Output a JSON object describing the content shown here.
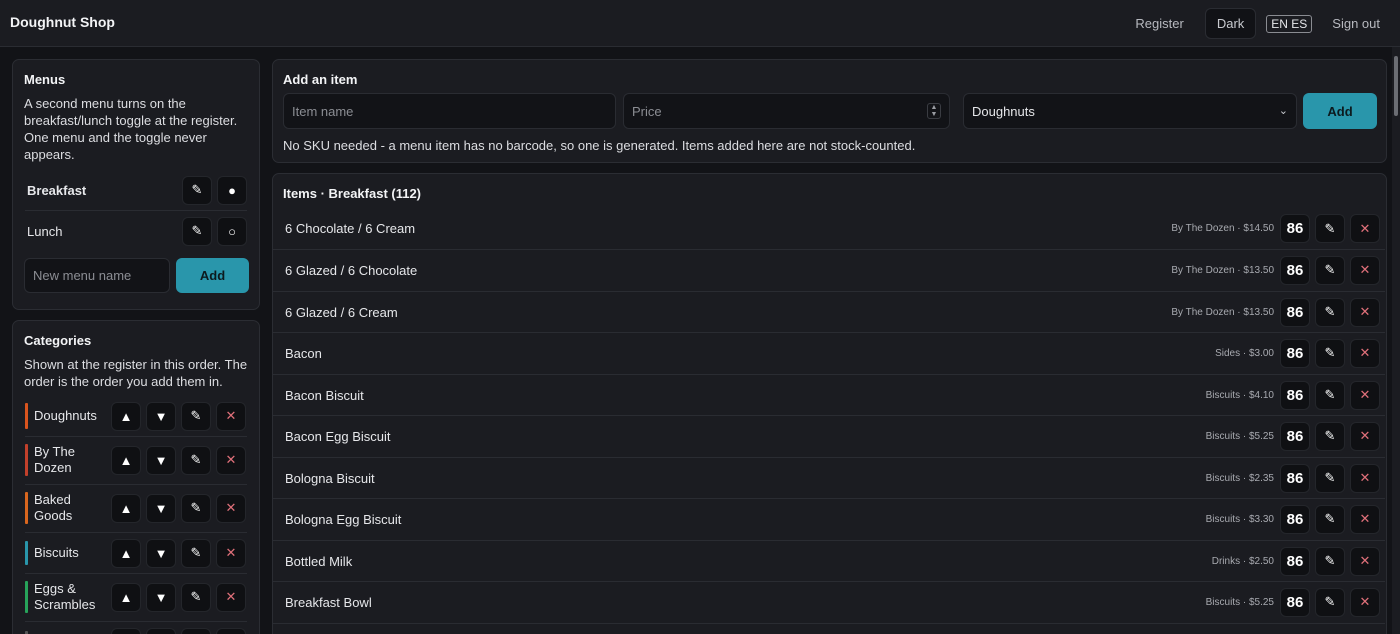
{
  "header": {
    "brand": "Doughnut Shop",
    "register": "Register",
    "theme": "Dark",
    "language": "EN ES",
    "signout": "Sign out"
  },
  "menus": {
    "title": "Menus",
    "description": "A second menu turns on the breakfast/lunch toggle at the register. One menu and the toggle never appears.",
    "items": [
      {
        "name": "Breakfast",
        "active": true,
        "status_icon": "●"
      },
      {
        "name": "Lunch",
        "active": false,
        "status_icon": "○"
      }
    ],
    "new_placeholder": "New menu name",
    "add_label": "Add"
  },
  "categories": {
    "title": "Categories",
    "description": "Shown at the register in this order. The order is the order you add them in.",
    "items": [
      {
        "name": "Doughnuts",
        "color": "#d9541e"
      },
      {
        "name": "By The Dozen",
        "color": "#c2402b"
      },
      {
        "name": "Baked Goods",
        "color": "#d9661e"
      },
      {
        "name": "Biscuits",
        "color": "#2996ab"
      },
      {
        "name": "Eggs & Scrambles",
        "color": "#27a35a"
      }
    ]
  },
  "add_item": {
    "title": "Add an item",
    "name_placeholder": "Item name",
    "price_placeholder": "Price",
    "category_selected": "Doughnuts",
    "add_label": "Add",
    "note": "No SKU needed - a menu item has no barcode, so one is generated. Items added here are not stock-counted."
  },
  "items": {
    "title": "Items · Breakfast (112)",
    "badge": "86",
    "rows": [
      {
        "name": "6 Chocolate / 6 Cream",
        "meta": "By The Dozen · $14.50"
      },
      {
        "name": "6 Glazed / 6 Chocolate",
        "meta": "By The Dozen · $13.50"
      },
      {
        "name": "6 Glazed / 6 Cream",
        "meta": "By The Dozen · $13.50"
      },
      {
        "name": "Bacon",
        "meta": "Sides · $3.00"
      },
      {
        "name": "Bacon Biscuit",
        "meta": "Biscuits · $4.10"
      },
      {
        "name": "Bacon Egg Biscuit",
        "meta": "Biscuits · $5.25"
      },
      {
        "name": "Bologna Biscuit",
        "meta": "Biscuits · $2.35"
      },
      {
        "name": "Bologna Egg Biscuit",
        "meta": "Biscuits · $3.30"
      },
      {
        "name": "Bottled Milk",
        "meta": "Drinks · $2.50"
      },
      {
        "name": "Breakfast Bowl",
        "meta": "Biscuits · $5.25"
      }
    ]
  }
}
